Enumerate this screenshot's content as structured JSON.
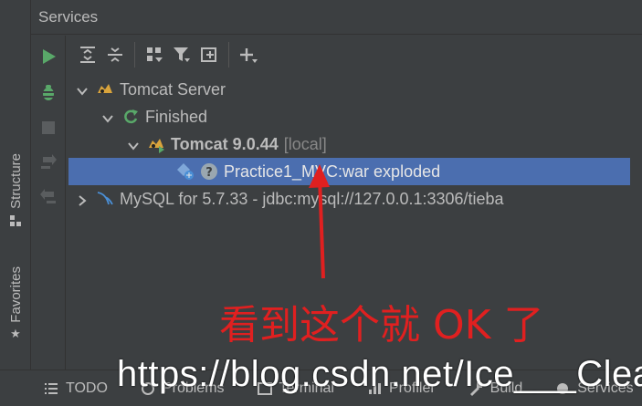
{
  "panel": {
    "title": "Services"
  },
  "side_tabs": [
    {
      "label": "Structure",
      "icon": "structure-icon"
    },
    {
      "label": "Favorites",
      "icon": "star-icon"
    }
  ],
  "actions": [
    "run-icon",
    "debug-icon",
    "stop-icon",
    "deploy-icon",
    "undeploy-icon"
  ],
  "toolbar": [
    "expand-all-icon",
    "collapse-all-icon",
    "group-icon",
    "filter-icon",
    "new-window-icon",
    "add-icon"
  ],
  "tree": {
    "root": "Tomcat Server",
    "finished": "Finished",
    "tomcat_name": "Tomcat 9.0.44",
    "tomcat_suffix": "[local]",
    "artifact": "Practice1_MVC:war exploded",
    "mysql": "MySQL for 5.7.33 - jdbc:mysql://127.0.0.1:3306/tieba"
  },
  "bottom_tabs": [
    {
      "label": "TODO"
    },
    {
      "label": "Problems"
    },
    {
      "label": "Terminal"
    },
    {
      "label": "Profiler"
    },
    {
      "label": "Build"
    },
    {
      "label": "Services"
    }
  ],
  "annotation": "看到这个就 OK 了",
  "watermark": "https://blog.csdn.net/Ice___Clean",
  "colors": {
    "selection": "#4b6eaf",
    "annotation": "#e02020",
    "run": "#59a869"
  }
}
